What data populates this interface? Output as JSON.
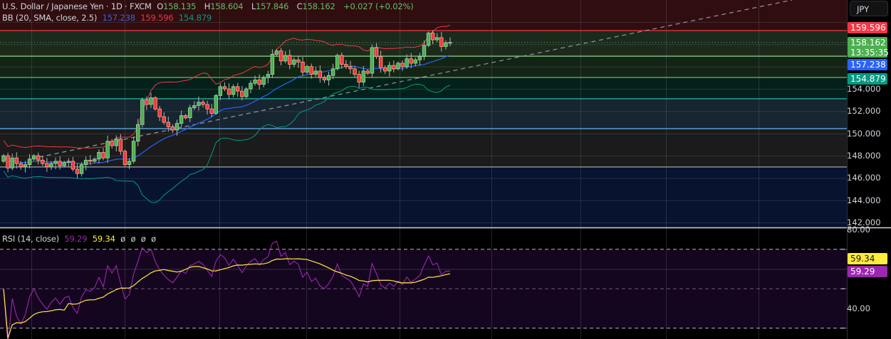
{
  "header": {
    "symbol_title": "U.S. Dollar / Japanese Yen · 1D · FXCM",
    "open_label": "O",
    "open": "158.135",
    "high_label": "H",
    "high": "158.604",
    "low_label": "L",
    "low": "157.846",
    "close_label": "C",
    "close": "158.162",
    "change": "+0.027 (+0.02%)"
  },
  "bb_legend": {
    "name": "BB (20, SMA, close, 2.5)",
    "basis": "157.238",
    "upper": "159.596",
    "lower": "154.879"
  },
  "rsi_legend": {
    "name": "RSI (14, close)",
    "rsi": "59.29",
    "ma": "59.34",
    "placeholders": [
      "ø",
      "ø",
      "ø",
      "ø"
    ]
  },
  "currency_button": "JPY",
  "price_tags": {
    "upper": "159.596",
    "last": "158.162",
    "countdown": "13:35:35",
    "basis": "157.238",
    "lower": "154.879"
  },
  "rsi_tags": {
    "ma": "59.34",
    "rsi": "59.29"
  },
  "colors": {
    "up": "#4caf50",
    "down": "#f23645",
    "bb_upper": "#f23645",
    "bb_basis": "#2962ff",
    "bb_lower": "#089981",
    "rsi": "#9c27b0",
    "rsi_ma": "#ffeb3b"
  },
  "chart_data": {
    "type": "candlestick",
    "title": "U.S. Dollar / Japanese Yen · 1D · FXCM",
    "ylim": [
      141.5,
      162
    ],
    "y_ticks": [
      "142.000",
      "144.000",
      "146.000",
      "148.000",
      "150.000",
      "152.000",
      "154.000"
    ],
    "y_tick_values": [
      142,
      144,
      146,
      148,
      150,
      152,
      154
    ],
    "first_open": 147.5,
    "closes": [
      148.0,
      146.9,
      147.8,
      147.3,
      147.0,
      147.2,
      147.7,
      148.0,
      147.6,
      147.3,
      147.0,
      147.3,
      147.5,
      147.1,
      147.4,
      147.5,
      146.8,
      146.4,
      147.2,
      147.6,
      147.5,
      147.7,
      148.3,
      147.8,
      149.3,
      148.9,
      149.5,
      148.4,
      147.2,
      147.5,
      149.3,
      150.8,
      153.0,
      152.6,
      153.2,
      152.2,
      151.5,
      151.0,
      150.6,
      150.3,
      150.9,
      151.6,
      151.4,
      152.3,
      152.5,
      152.8,
      152.6,
      152.2,
      151.8,
      153.4,
      154.2,
      154.0,
      153.5,
      154.2,
      153.8,
      153.3,
      154.0,
      154.5,
      154.8,
      154.4,
      155.0,
      155.3,
      157.1,
      157.4,
      156.5,
      157.0,
      156.2,
      156.6,
      156.4,
      155.5,
      156.0,
      155.3,
      155.6,
      155.0,
      154.8,
      155.2,
      155.8,
      157.0,
      156.2,
      156.0,
      155.8,
      155.3,
      154.6,
      155.6,
      155.4,
      157.7,
      156.9,
      155.9,
      155.6,
      156.1,
      155.8,
      156.3,
      156.0,
      156.7,
      156.3,
      156.6,
      156.9,
      157.9,
      159.0,
      158.4,
      158.6,
      157.8,
      158.135,
      158.162
    ],
    "last_candle": {
      "open": 158.135,
      "high": 158.604,
      "low": 157.846,
      "close": 158.162
    },
    "current_price": 158.162,
    "bollinger": {
      "period": 20,
      "mult": 2.5,
      "basis": 157.238,
      "upper": 159.596,
      "lower": 154.879
    },
    "horizontal_levels": [
      {
        "price": 159.23,
        "color": "#f23645"
      },
      {
        "price": 156.93,
        "color": "#81c784"
      },
      {
        "price": 155.02,
        "color": "#66bb6a"
      },
      {
        "price": 153.11,
        "color": "#26a69a"
      },
      {
        "price": 150.43,
        "color": "#64b5f6"
      },
      {
        "price": 146.99,
        "color": "#9598a1"
      }
    ],
    "rsi": {
      "period": 14,
      "ma_period": 14,
      "ylim": [
        25,
        80
      ],
      "y_ticks": [
        "80.00",
        "40.00"
      ],
      "y_tick_values": [
        80,
        40
      ],
      "bands": [
        70,
        50,
        30
      ],
      "last_rsi": 59.29,
      "last_ma": 59.34
    }
  }
}
